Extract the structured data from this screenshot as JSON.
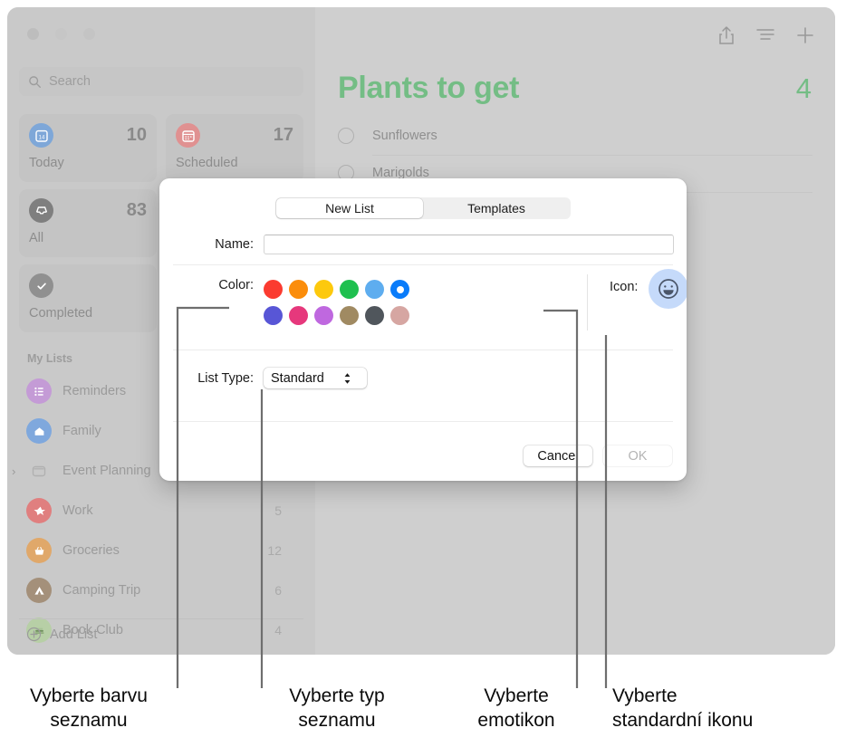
{
  "app": {
    "search": {
      "placeholder": "Search",
      "icon": "search-icon"
    },
    "smart_cards": [
      {
        "label": "Today",
        "count": "10",
        "icon": "calendar-day-icon",
        "color": "#7ea7d8"
      },
      {
        "label": "Scheduled",
        "count": "17",
        "icon": "calendar-icon",
        "color": "#e09191"
      },
      {
        "label": "All",
        "count": "83",
        "icon": "inbox-tray-icon",
        "color": "#7f7f7f"
      },
      {
        "label": "Completed",
        "count": "",
        "icon": "checkmark-circle-icon",
        "color": "#909090"
      }
    ],
    "my_lists_header": "My Lists",
    "lists": [
      {
        "label": "Reminders",
        "count": "",
        "icon": "list-bullet-icon",
        "color": "#c49bd6",
        "expandable": false
      },
      {
        "label": "Family",
        "count": "",
        "icon": "house-icon",
        "color": "#7fa8dd",
        "expandable": false
      },
      {
        "label": "Event Planning",
        "count": "",
        "icon": "folder-icon",
        "color": "#b9b9b9",
        "expandable": true
      },
      {
        "label": "Work",
        "count": "5",
        "icon": "star-icon",
        "color": "#e07f7f",
        "expandable": false
      },
      {
        "label": "Groceries",
        "count": "12",
        "icon": "basket-icon",
        "color": "#e0a86a",
        "expandable": false
      },
      {
        "label": "Camping Trip",
        "count": "6",
        "icon": "tent-icon",
        "color": "#a4907a",
        "expandable": false
      },
      {
        "label": "Book Club",
        "count": "4",
        "icon": "books-icon",
        "color": "#b7cfa6",
        "expandable": false
      }
    ],
    "add_list_label": "Add List",
    "add_list_icon": "plus-circle-icon",
    "toolbar_icons": [
      "share-icon",
      "list-view-icon",
      "add-reminder-icon"
    ],
    "detail": {
      "title": "Plants to get",
      "count": "4",
      "accent_color": "#74bd85",
      "reminders": [
        {
          "text": "Sunflowers"
        },
        {
          "text": "Marigolds"
        }
      ]
    }
  },
  "dialog": {
    "tabs": [
      {
        "label": "New List",
        "active": true
      },
      {
        "label": "Templates",
        "active": false
      }
    ],
    "name": {
      "label": "Name:",
      "value": "",
      "placeholder": ""
    },
    "color": {
      "label": "Color:",
      "selected_index": 5,
      "swatches": [
        "#fb3b30",
        "#fb8d0b",
        "#fdc90d",
        "#1fc04f",
        "#5eadef",
        "#0a7cfa",
        "#5856d6",
        "#e6387c",
        "#bf68df",
        "#a08a62",
        "#50565c",
        "#d6a6a2"
      ]
    },
    "icon": {
      "label": "Icon:",
      "options": [
        {
          "name": "emoji-icon",
          "selected": false
        },
        {
          "name": "standard-list-icon",
          "selected": true
        }
      ],
      "selected_fill": "#1b7eed",
      "emoji_fill": "#c5dafa"
    },
    "list_type": {
      "label": "List Type:",
      "value": "Standard",
      "options": [
        "Standard"
      ]
    },
    "buttons": [
      {
        "label": "Cancel",
        "disabled": false
      },
      {
        "label": "OK",
        "disabled": true
      }
    ]
  },
  "callouts": [
    {
      "text_line1": "Vyberte barvu",
      "text_line2": "seznamu",
      "target": "color-swatches"
    },
    {
      "text_line1": "Vyberte typ",
      "text_line2": "seznamu",
      "target": "list-type-popup"
    },
    {
      "text_line1": "Vyberte",
      "text_line2": "emotikon",
      "target": "emoji-icon-button"
    },
    {
      "text_line1": "Vyberte",
      "text_line2": "standardní ikonu",
      "target": "standard-icon-button"
    }
  ]
}
